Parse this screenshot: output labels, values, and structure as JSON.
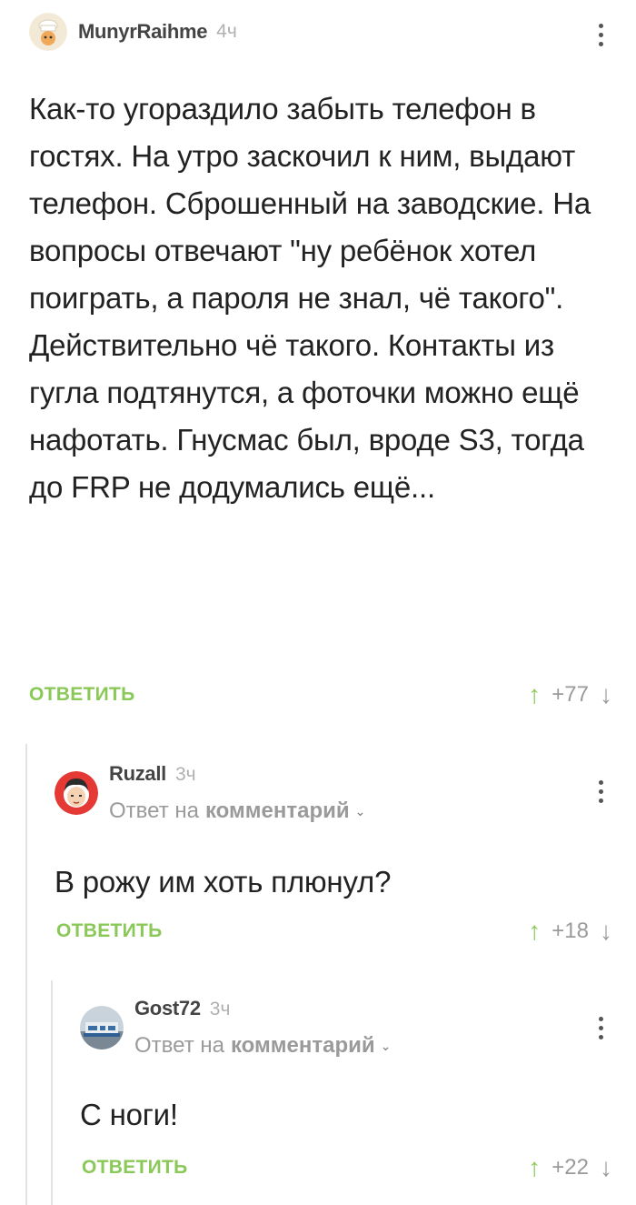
{
  "comments": [
    {
      "author": "MunyrRaihme",
      "time": "4ч",
      "text": "Как-то угораздило забыть телефон в гостях. На утро заскочил к ним, выдают телефон. Сброшенный на заводские. На вопросы отвечают \"ну ребёнок хотел поиграть, а пароля не знал, чё такого\". Действительно чё такого. Контакты из гугла подтянутся, а фоточки можно ещё нафотать. Гнусмас был, вроде S3, тогда до FRP не додумались ещё...",
      "reply_label": "ОТВЕТИТЬ",
      "rating": "+77"
    },
    {
      "author": "Ruzall",
      "time": "3ч",
      "reply_to_prefix": "Ответ на",
      "reply_to_link": "комментарий",
      "text": "В рожу им хоть плюнул?",
      "reply_label": "ОТВЕТИТЬ",
      "rating": "+18"
    },
    {
      "author": "Gost72",
      "time": "3ч",
      "reply_to_prefix": "Ответ на",
      "reply_to_link": "комментарий",
      "text": "С ноги!",
      "reply_label": "ОТВЕТИТЬ",
      "rating": "+22"
    }
  ],
  "icons": {
    "upvote": "arrow-up-icon",
    "downvote": "arrow-down-icon",
    "menu": "more-vertical-icon",
    "expand": "chevron-down-icon"
  },
  "colors": {
    "accent_green": "#8ac858",
    "muted_gray": "#9a9a9a",
    "thread_line": "#e3e3e3"
  }
}
